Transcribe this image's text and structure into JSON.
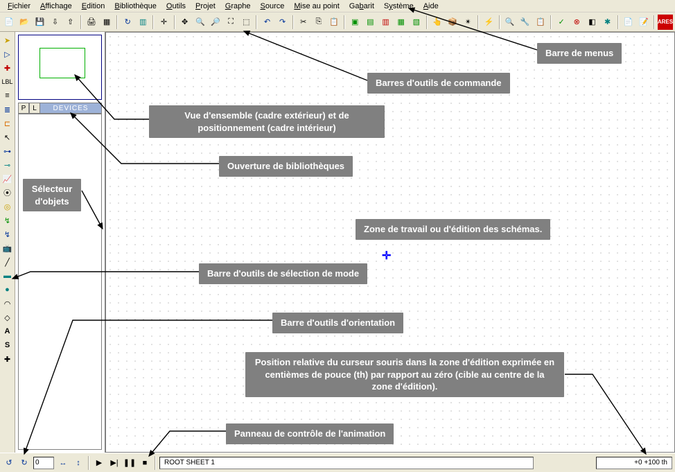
{
  "menu": {
    "fichier": "Fichier",
    "affichage": "Affichage",
    "edition": "Edition",
    "bibliotheque": "Bibliothèque",
    "outils": "Outils",
    "projet": "Projet",
    "graphe": "Graphe",
    "source": "Source",
    "miseaupoint": "Mise au point",
    "gabarit": "Gabarit",
    "systeme": "Système",
    "aide": "Aide"
  },
  "side": {
    "p": "P",
    "l": "L",
    "devices": "DEVICES"
  },
  "status": {
    "angle": "0",
    "sheet": "ROOT SHEET 1",
    "coords": "+0      +100   th"
  },
  "callouts": {
    "menus": "Barre de menus",
    "cmdtoolbars": "Barres d'outils de commande",
    "overview": "Vue d'ensemble (cadre extérieur) et de positionnement (cadre intérieur)",
    "library": "Ouverture de bibliothèques",
    "selector": "Sélecteur d'objets",
    "workzone": "Zone de travail ou d'édition des schémas.",
    "modebar": "Barre d'outils de sélection de mode",
    "orientbar": "Barre d'outils d'orientation",
    "cursorpos": "Position relative du curseur souris dans la zone d'édition exprimée en centièmes de pouce (th) par rapport au zéro (cible au centre de la zone d'édition).",
    "animation": "Panneau de contrôle de l'animation"
  }
}
